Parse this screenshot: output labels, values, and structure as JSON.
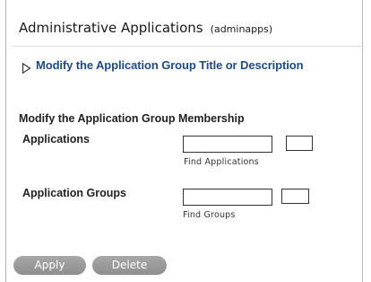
{
  "header": {
    "title": "Administrative Applications",
    "subtitle": "(adminapps)"
  },
  "expander": {
    "icon": "triangle-right-icon",
    "link_label": "Modify the Application Group Title or Description"
  },
  "membership": {
    "section_title": "Modify the Application Group Membership",
    "applications": {
      "label": "Applications",
      "value": "",
      "placeholder": "",
      "hint": "Find Applications"
    },
    "application_groups": {
      "label": "Application Groups",
      "value": "",
      "placeholder": "",
      "hint": "Find Groups"
    }
  },
  "actions": {
    "apply_label": "Apply",
    "delete_label": "Delete"
  },
  "colors": {
    "link": "#1d4a86",
    "button": "#999999",
    "border": "#b9b9b9"
  }
}
